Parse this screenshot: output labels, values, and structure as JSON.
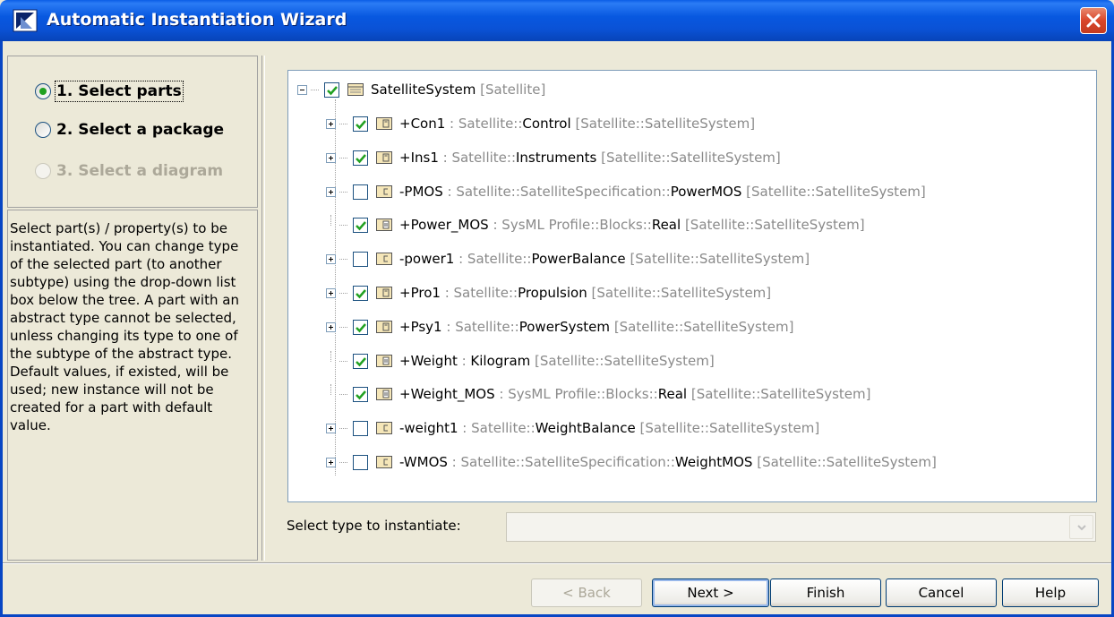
{
  "window": {
    "title": "Automatic Instantiation Wizard"
  },
  "steps": [
    {
      "label": "1. Select parts",
      "state": "selected"
    },
    {
      "label": "2. Select a package",
      "state": "enabled"
    },
    {
      "label": "3. Select a diagram",
      "state": "disabled"
    }
  ],
  "description": "Select part(s) / property(s) to be instantiated. You can change type of the selected part (to another subtype) using the drop-down list box below the tree. A part with an abstract type cannot be selected, unless changing its type to one of the subtype of the abstract type. Default values, if existed, will be used; new instance will not be created for a part with default value.",
  "tree": {
    "root": {
      "name": "SatelliteSystem",
      "owner": "[Satellite]",
      "checked": true,
      "icon": "block-icon"
    },
    "items": [
      {
        "name": "+Con1",
        "type_prefix": "Satellite::",
        "type": "Control",
        "owner": "[Satellite::SatelliteSystem]",
        "checked": true,
        "expandable": true,
        "icon": "part-icon"
      },
      {
        "name": "+Ins1",
        "type_prefix": "Satellite::",
        "type": "Instruments",
        "owner": "[Satellite::SatelliteSystem]",
        "checked": true,
        "expandable": true,
        "icon": "part-icon"
      },
      {
        "name": "-PMOS",
        "type_prefix": "Satellite::SatelliteSpecification::",
        "type": "PowerMOS",
        "owner": "[Satellite::SatelliteSystem]",
        "checked": false,
        "expandable": true,
        "icon": "constraint-icon"
      },
      {
        "name": "+Power_MOS",
        "type_prefix": "SysML Profile::Blocks::",
        "type": "Real",
        "owner": "[Satellite::SatelliteSystem]",
        "checked": true,
        "expandable": false,
        "icon": "value-icon"
      },
      {
        "name": "-power1",
        "type_prefix": "Satellite::",
        "type": "PowerBalance",
        "owner": "[Satellite::SatelliteSystem]",
        "checked": false,
        "expandable": true,
        "icon": "constraint-icon"
      },
      {
        "name": "+Pro1",
        "type_prefix": "Satellite::",
        "type": "Propulsion",
        "owner": "[Satellite::SatelliteSystem]",
        "checked": true,
        "expandable": true,
        "icon": "part-icon"
      },
      {
        "name": "+Psy1",
        "type_prefix": "Satellite::",
        "type": "PowerSystem",
        "owner": "[Satellite::SatelliteSystem]",
        "checked": true,
        "expandable": true,
        "icon": "part-icon"
      },
      {
        "name": "+Weight",
        "type_prefix": "",
        "type": "Kilogram",
        "owner": "[Satellite::SatelliteSystem]",
        "checked": true,
        "expandable": false,
        "icon": "value-icon"
      },
      {
        "name": "+Weight_MOS",
        "type_prefix": "SysML Profile::Blocks::",
        "type": "Real",
        "owner": "[Satellite::SatelliteSystem]",
        "checked": true,
        "expandable": false,
        "icon": "value-icon"
      },
      {
        "name": "-weight1",
        "type_prefix": "Satellite::",
        "type": "WeightBalance",
        "owner": "[Satellite::SatelliteSystem]",
        "checked": false,
        "expandable": true,
        "icon": "constraint-icon"
      },
      {
        "name": "-WMOS",
        "type_prefix": "Satellite::SatelliteSpecification::",
        "type": "WeightMOS",
        "owner": "[Satellite::SatelliteSystem]",
        "checked": false,
        "expandable": true,
        "icon": "constraint-icon"
      }
    ]
  },
  "type_select": {
    "label": "Select type to instantiate:",
    "value": ""
  },
  "buttons": {
    "back": "< Back",
    "next": "Next >",
    "finish": "Finish",
    "cancel": "Cancel",
    "help": "Help"
  },
  "colors": {
    "title_bar": "#0a52d6",
    "check_green": "#21a121",
    "gray_text": "#8a8a8a"
  }
}
